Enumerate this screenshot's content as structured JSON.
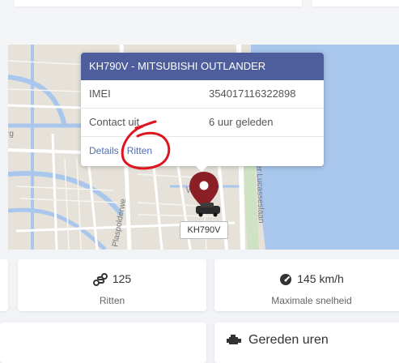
{
  "popup": {
    "title": "KH790V - MITSUBISHI OUTLANDER",
    "rows": [
      {
        "key": "IMEI",
        "value": "354017116322898"
      },
      {
        "key": "Contact uit",
        "value": "6 uur geleden"
      }
    ],
    "links": {
      "details": "Details",
      "separator": "/",
      "trips": "Ritten"
    }
  },
  "map": {
    "marker_plate": "KH790V",
    "street_labels": [
      "Watergr",
      "Plaspolderwe",
      "ster Lucasseslaan",
      "rg"
    ]
  },
  "stats": [
    {
      "value": "125",
      "label": "Ritten",
      "icon": "route-icon"
    },
    {
      "value": "145 km/h",
      "label": "Maximale snelheid",
      "icon": "speedometer-icon"
    }
  ],
  "sections": {
    "driven_hours": "Gereden uren",
    "driven_hours_icon": "engine-icon"
  },
  "colors": {
    "popup_header": "#4e5d9c",
    "marker": "#8a1f26",
    "link": "#4f6fb0",
    "water": "#a9c7ec",
    "annotation": "#e0141e"
  }
}
